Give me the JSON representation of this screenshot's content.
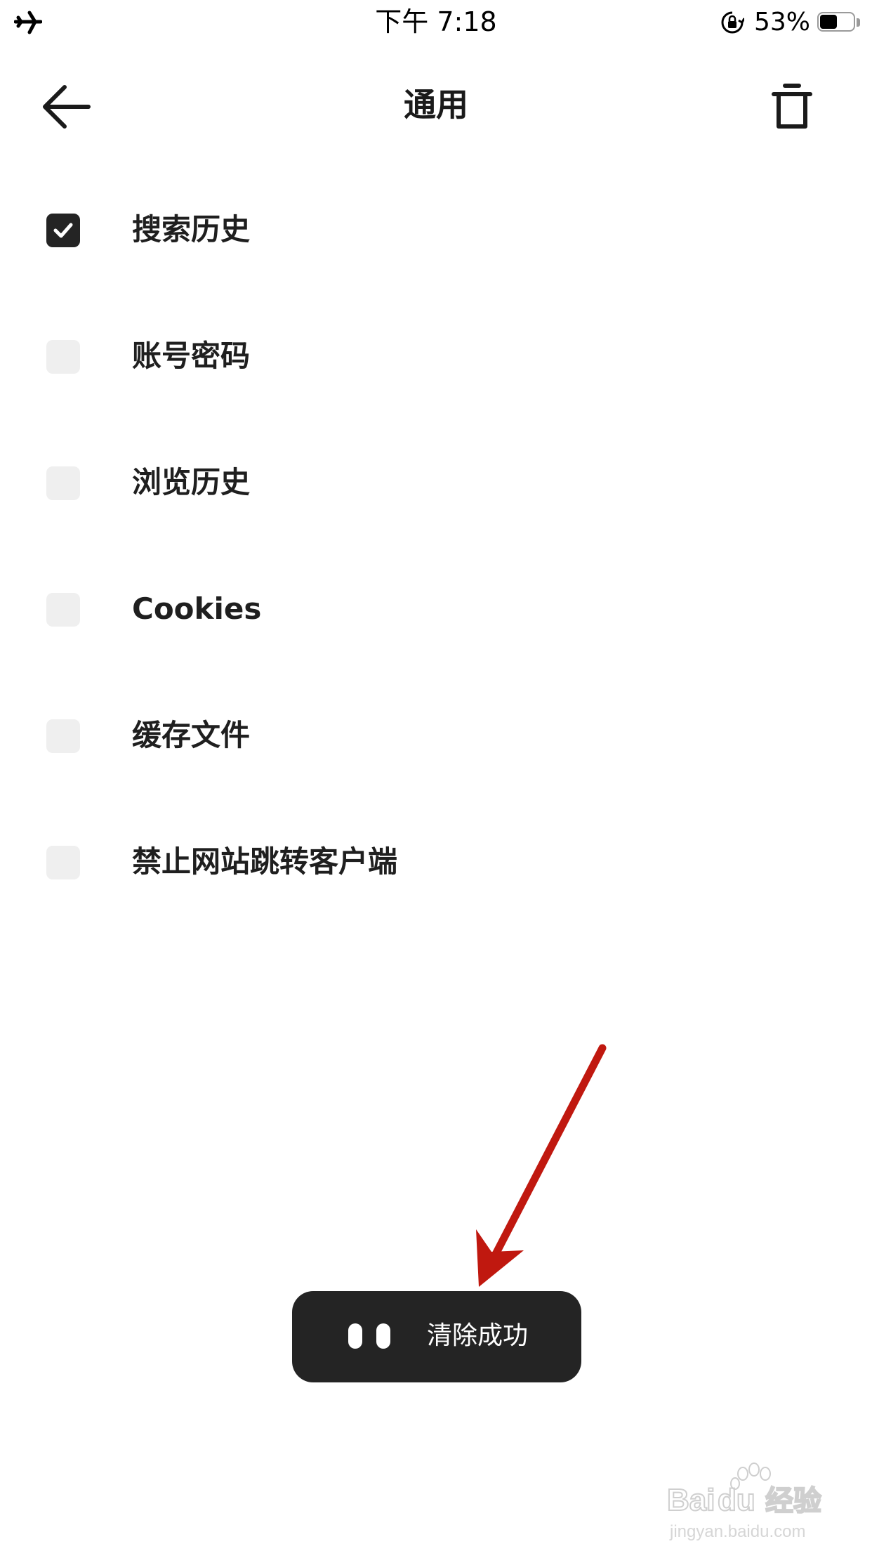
{
  "status_bar": {
    "time": "下午 7:18",
    "battery_percent": "53%",
    "battery_level": 0.53,
    "icons": [
      "airplane-icon",
      "orientation-lock-icon",
      "battery-icon"
    ]
  },
  "header": {
    "title": "通用",
    "back_icon": "arrow-left-icon",
    "delete_icon": "trash-icon"
  },
  "options": [
    {
      "label": "搜索历史",
      "checked": true
    },
    {
      "label": "账号密码",
      "checked": false
    },
    {
      "label": "浏览历史",
      "checked": false
    },
    {
      "label": "Cookies",
      "checked": false
    },
    {
      "label": "缓存文件",
      "checked": false
    },
    {
      "label": "禁止网站跳转客户端",
      "checked": false
    }
  ],
  "toast": {
    "text": "清除成功",
    "icon": "eyes-icon"
  },
  "annotation": {
    "arrow_color": "#c0180f"
  },
  "watermark": {
    "brand": "Baidu经验",
    "site": "jingyan.baidu.com"
  },
  "colors": {
    "checkbox_checked": "#242424",
    "checkbox_unchecked": "#efefef",
    "toast_background": "#242424"
  }
}
